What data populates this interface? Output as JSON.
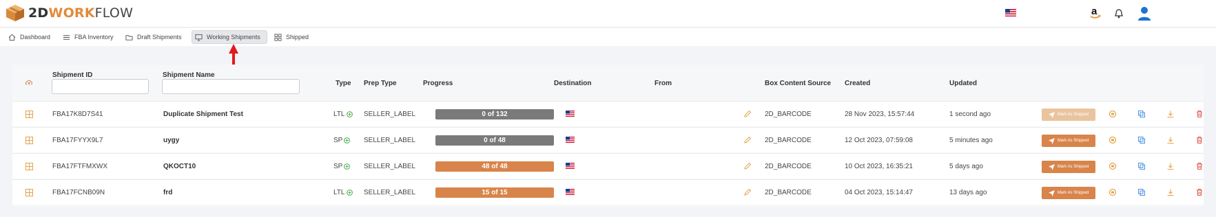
{
  "app": {
    "logo_2d": "2D",
    "logo_work": "WORK",
    "logo_flow": "FLOW"
  },
  "colors": {
    "accent": "#e08a3c",
    "progress_gray": "#7a7a7a",
    "progress_orange": "#d8844a",
    "mark_disabled": "#e9c49f",
    "mark_enabled": "#d8844a",
    "icon_orange": "#e6a24a",
    "icon_blue": "#4a90e2",
    "icon_red": "#e05a4f"
  },
  "nav": [
    {
      "label": "Dashboard",
      "icon": "home-icon"
    },
    {
      "label": "FBA Inventory",
      "icon": "list-icon"
    },
    {
      "label": "Draft Shipments",
      "icon": "folder-icon"
    },
    {
      "label": "Working Shipments",
      "icon": "monitor-icon",
      "active": true
    },
    {
      "label": "Shipped",
      "icon": "grid-icon"
    }
  ],
  "table": {
    "headers": {
      "shipment_id": "Shipment ID",
      "shipment_name": "Shipment Name",
      "type": "Type",
      "prep_type": "Prep Type",
      "progress": "Progress",
      "destination": "Destination",
      "from": "From",
      "box_content_source": "Box Content Source",
      "created": "Created",
      "updated": "Updated"
    },
    "filters": {
      "shipment_id": "",
      "shipment_name": ""
    },
    "mark_label": "Mark As Shipped",
    "rows": [
      {
        "id": "FBA17K8D7S41",
        "name": "Duplicate Shipment Test",
        "type": "LTL",
        "prep": "SELLER_LABEL",
        "progress": "0 of 132",
        "progress_fraction": 0,
        "source": "2D_BARCODE",
        "created": "28 Nov 2023, 15:57:44",
        "updated": "1 second ago",
        "mark_enabled": false
      },
      {
        "id": "FBA17FYYX9L7",
        "name": "uygy",
        "type": "SP",
        "prep": "SELLER_LABEL",
        "progress": "0 of 48",
        "progress_fraction": 0,
        "source": "2D_BARCODE",
        "created": "12 Oct 2023, 07:59:08",
        "updated": "5 minutes ago",
        "mark_enabled": true
      },
      {
        "id": "FBA17FTFMXWX",
        "name": "QKOCT10",
        "type": "SP",
        "prep": "SELLER_LABEL",
        "progress": "48 of 48",
        "progress_fraction": 1,
        "source": "2D_BARCODE",
        "created": "10 Oct 2023, 16:35:21",
        "updated": "5 days ago",
        "mark_enabled": true
      },
      {
        "id": "FBA17FCNB09N",
        "name": "frd",
        "type": "LTL",
        "prep": "SELLER_LABEL",
        "progress": "15 of 15",
        "progress_fraction": 1,
        "source": "2D_BARCODE",
        "created": "04 Oct 2023, 15:14:47",
        "updated": "13 days ago",
        "mark_enabled": true
      }
    ]
  }
}
